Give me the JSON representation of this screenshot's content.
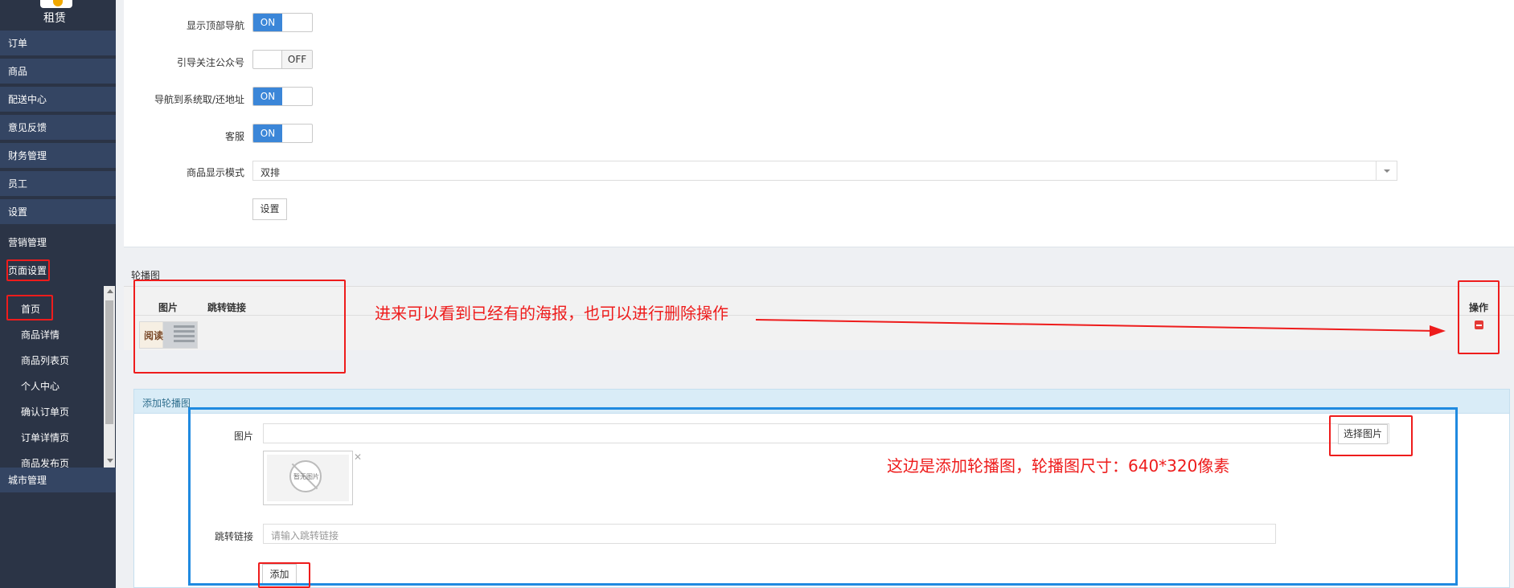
{
  "sidebar": {
    "brand": "租赁",
    "menu": [
      {
        "label": "订单"
      },
      {
        "label": "商品"
      },
      {
        "label": "配送中心"
      },
      {
        "label": "意见反馈"
      },
      {
        "label": "财务管理"
      },
      {
        "label": "员工"
      },
      {
        "label": "设置"
      },
      {
        "label": "营销管理"
      },
      {
        "label": "页面设置"
      }
    ],
    "submenu": [
      {
        "label": "首页"
      },
      {
        "label": "商品详情"
      },
      {
        "label": "商品列表页"
      },
      {
        "label": "个人中心"
      },
      {
        "label": "确认订单页"
      },
      {
        "label": "订单详情页"
      },
      {
        "label": "商品发布页"
      }
    ],
    "bottom_menu": {
      "label": "城市管理"
    }
  },
  "settings": {
    "fields": [
      {
        "label": "显示顶部导航",
        "state": "ON"
      },
      {
        "label": "引导关注公众号",
        "state": "OFF"
      },
      {
        "label": "导航到系统取/还地址",
        "state": "ON"
      },
      {
        "label": "客服",
        "state": "ON"
      }
    ],
    "display_mode_label": "商品显示模式",
    "display_mode_value": "双排",
    "submit_label": "设置"
  },
  "carousel": {
    "title": "轮播图",
    "columns": {
      "image": "图片",
      "link": "跳转链接",
      "action": "操作"
    },
    "rows": [
      {
        "thumb_text": "阅读",
        "link": ""
      }
    ]
  },
  "add_carousel": {
    "title": "添加轮播图",
    "image_label": "图片",
    "select_button": "选择图片",
    "no_image_text": "暂无图片",
    "link_label": "跳转链接",
    "link_placeholder": "请输入跳转链接",
    "add_button": "添加"
  },
  "annotations": {
    "existing_posters": "进来可以看到已经有的海报，也可以进行删除操作",
    "add_info": "这边是添加轮播图，轮播图尺寸：640*320像素"
  },
  "colors": {
    "sidebar_bg": "#2b3446",
    "menu_bg": "#344563",
    "switch_on": "#3b86d8",
    "annotation_red": "#ee1c1c",
    "annotation_blue": "#1f8ae0"
  }
}
